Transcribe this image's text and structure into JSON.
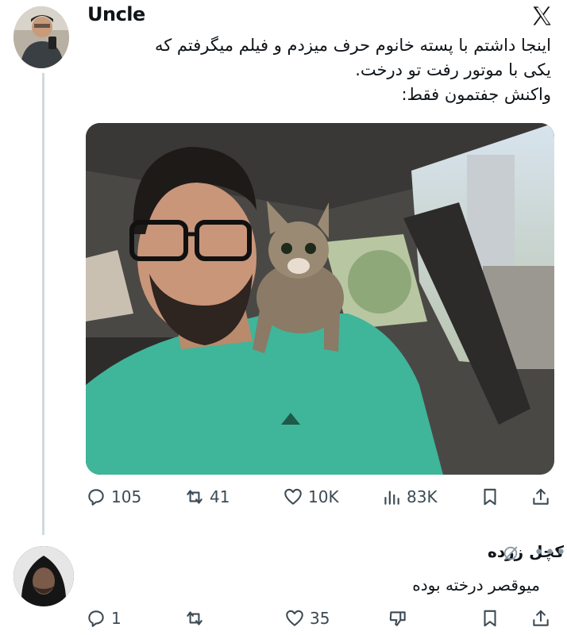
{
  "tweet": {
    "author": "Uncle",
    "text_lines": [
      "اینجا داشتم با پسته خانوم حرف میزدم و فیلم میگرفتم که",
      "یکی با موتور رفت تو درخت.",
      "واکنش جفتمون فقط:"
    ],
    "stats": {
      "replies": "105",
      "reposts": "41",
      "likes": "10K",
      "views": "83K"
    }
  },
  "reply": {
    "author": "کچل زرده",
    "text": "میوقصر درخته بوده",
    "stats": {
      "replies": "1",
      "likes": "35"
    }
  },
  "colors": {
    "shirt": "#3fb59a",
    "icon": "#3b4a54",
    "thread_line": "#cfd9de"
  },
  "icons": [
    "x-logo-icon",
    "reply-icon",
    "repost-icon",
    "like-icon",
    "views-icon",
    "bookmark-icon",
    "share-icon",
    "grok-icon",
    "more-icon",
    "dislike-icon"
  ]
}
